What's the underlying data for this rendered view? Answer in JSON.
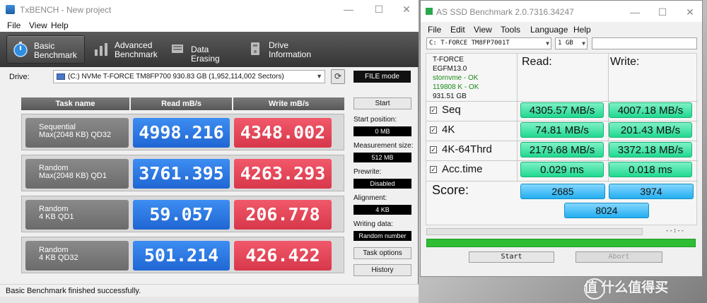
{
  "txbench": {
    "title": "TxBENCH - New project",
    "menu": [
      "File",
      "View",
      "Help"
    ],
    "toolbar": [
      {
        "label": "Basic\nBenchmark",
        "icon": "stopwatch-icon"
      },
      {
        "label": "Advanced\nBenchmark",
        "icon": "bar-chart-icon"
      },
      {
        "label": "Data Erasing",
        "icon": "eraser-icon"
      },
      {
        "label": "Drive\nInformation",
        "icon": "drive-icon"
      }
    ],
    "drive_label": "Drive:",
    "drive_value": "(C:) NVMe T-FORCE TM8FP700  930.83 GB (1,952,114,002 Sectors)",
    "file_mode": "FILE mode",
    "columns": [
      "Task name",
      "Read mB/s",
      "Write mB/s"
    ],
    "rows": [
      {
        "task": "Sequential\nMax(2048 KB) QD32",
        "read": "4998.216",
        "write": "4348.002"
      },
      {
        "task": "Random\nMax(2048 KB) QD1",
        "read": "3761.395",
        "write": "4263.293"
      },
      {
        "task": "Random\n4 KB QD1",
        "read": "59.057",
        "write": "206.778"
      },
      {
        "task": "Random\n4 KB QD32",
        "read": "501.214",
        "write": "426.422"
      }
    ],
    "side": {
      "start": "Start",
      "start_position_label": "Start position:",
      "start_position": "0 MB",
      "measurement_size_label": "Measurement size:",
      "measurement_size": "512 MB",
      "prewrite_label": "Prewrite:",
      "prewrite": "Disabled",
      "alignment_label": "Alignment:",
      "alignment": "4 KB",
      "writing_data_label": "Writing data:",
      "writing_data": "Random number",
      "task_options": "Task options",
      "history": "History"
    },
    "status": "Basic Benchmark finished successfully."
  },
  "asssd": {
    "title": "AS SSD Benchmark 2.0.7316.34247",
    "menu": [
      "File",
      "Edit",
      "View",
      "Tools",
      "Language",
      "Help"
    ],
    "drive_select": "C: T-FORCE TM8FP7001T",
    "size_select": "1 GB",
    "drive_info": {
      "model": "T-FORCE",
      "firmware": "EGFM13.0",
      "driver": "stornvme - OK",
      "alignment": "119808 K - OK",
      "capacity": "931.51 GB"
    },
    "headers": {
      "read": "Read:",
      "write": "Write:"
    },
    "tests": [
      {
        "name": "Seq",
        "read": "4305.57 MB/s",
        "write": "4007.18 MB/s"
      },
      {
        "name": "4K",
        "read": "74.81 MB/s",
        "write": "201.43 MB/s"
      },
      {
        "name": "4K-64Thrd",
        "read": "2179.68 MB/s",
        "write": "3372.18 MB/s"
      },
      {
        "name": "Acc.time",
        "read": "0.029 ms",
        "write": "0.018 ms"
      }
    ],
    "score_label": "Score:",
    "score_read": "2685",
    "score_write": "3974",
    "score_total": "8024",
    "elapsed": "--:--",
    "progress": 1.0,
    "start": "Start",
    "abort": "Abort"
  },
  "watermark": "值 什么值得买"
}
